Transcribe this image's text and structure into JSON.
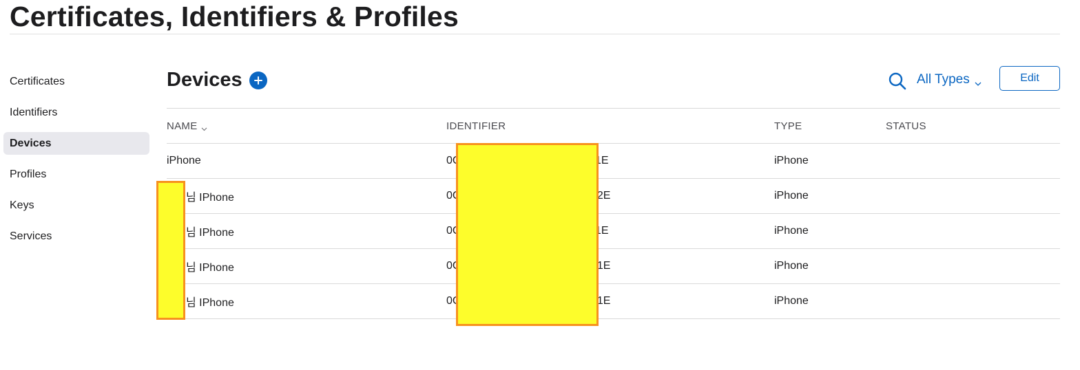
{
  "page": {
    "title": "Certificates, Identifiers & Profiles"
  },
  "sidebar": {
    "items": [
      {
        "label": "Certificates"
      },
      {
        "label": "Identifiers"
      },
      {
        "label": "Devices",
        "active": true
      },
      {
        "label": "Profiles"
      },
      {
        "label": "Keys"
      },
      {
        "label": "Services"
      }
    ]
  },
  "header": {
    "section_title": "Devices",
    "add_icon": "plus-circle-icon",
    "search_icon": "search-icon",
    "filter_label": "All Types",
    "edit_label": "Edit"
  },
  "table": {
    "columns": {
      "name": "NAME",
      "identifier": "IDENTIFIER",
      "type": "TYPE",
      "status": "STATUS"
    },
    "rows": [
      {
        "name": "iPhone",
        "id_prefix": "0C",
        "id_suffix": "1E",
        "type": "iPhone",
        "status": ""
      },
      {
        "name": "님 IPhone",
        "id_prefix": "0C",
        "id_suffix": "02E",
        "type": "iPhone",
        "status": ""
      },
      {
        "name": "님 IPhone",
        "id_prefix": "0C",
        "id_suffix": "1E",
        "type": "iPhone",
        "status": ""
      },
      {
        "name": "님 IPhone",
        "id_prefix": "0C",
        "id_suffix": "01E",
        "type": "iPhone",
        "status": ""
      },
      {
        "name": "님 IPhone",
        "id_prefix": "0C",
        "id_suffix": "01E",
        "type": "iPhone",
        "status": ""
      }
    ]
  },
  "colors": {
    "accent": "#0a66c2",
    "redaction_fill": "#fdfd2b",
    "redaction_border": "#f7911e"
  }
}
